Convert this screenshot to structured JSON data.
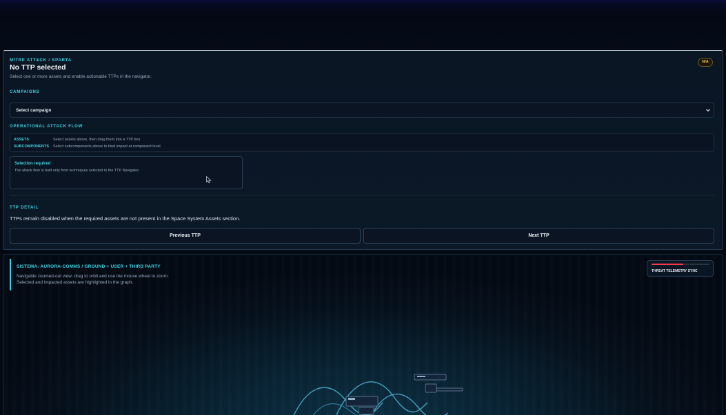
{
  "ttp_panel": {
    "kicker": "MITRE ATT&CK / SPARTA",
    "title": "No TTP selected",
    "subtitle": "Select one or more assets and enable actionable TTPs in the navigator.",
    "badge": "N/A",
    "campaigns_label": "CAMPAIGNS",
    "campaign_select": "Select campaign",
    "flow_label": "OPERATIONAL ATTACK FLOW",
    "flow_rows": [
      {
        "key": "ASSETS",
        "text": "Select assets above, then drag them into a TTP box."
      },
      {
        "key": "SUBCOMPONENTS",
        "text": "Select subcomponents above to bind impact at component level."
      }
    ],
    "selection_box": {
      "heading": "Selection required",
      "text": "The attack flow is built only from techniques selected in the TTP Navigator."
    },
    "detail_label": "TTP DETAIL",
    "detail_note": "TTPs remain disabled when the required assets are not present in the Space System Assets section.",
    "prev_button": "Previous TTP",
    "next_button": "Next TTP"
  },
  "system_view": {
    "title": "SISTEMA: AURORA-COMMS / GROUND + USER + THIRD PARTY",
    "description": "Navigable zoomed-out view: drag to orbit and use the mouse wheel to zoom. Selected and impacted assets are highlighted in the graph.",
    "telemetry_label": "THREAT TELEMETRY SYNC",
    "telemetry_level": 0.55
  },
  "colors": {
    "accent": "#3fd2e0",
    "badge": "#e8c64a",
    "telemetry": "#ff3b4e"
  }
}
